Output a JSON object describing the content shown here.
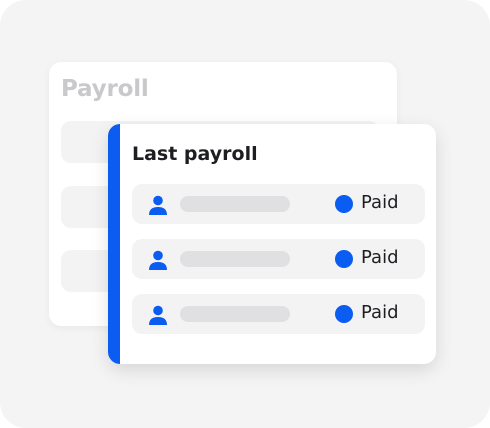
{
  "back_card": {
    "title": "Payroll"
  },
  "front_card": {
    "title": "Last payroll",
    "rows": [
      {
        "status": "Paid",
        "icon": "user-icon"
      },
      {
        "status": "Paid",
        "icon": "user-icon"
      },
      {
        "status": "Paid",
        "icon": "user-icon"
      }
    ]
  },
  "colors": {
    "accent": "#0b5cf0",
    "placeholder": "#e0e0e2",
    "row_background": "#f3f3f4"
  }
}
